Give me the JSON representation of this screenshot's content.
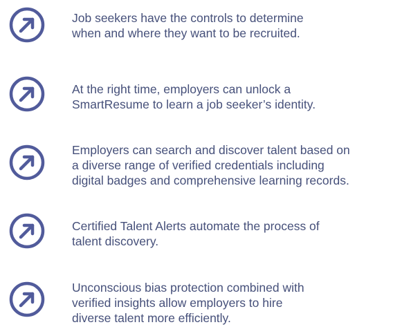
{
  "colors": {
    "icon": "#515b9b",
    "text": "#46507a",
    "background": "#ffffff"
  },
  "icon_name": "arrow-up-right-circle-icon",
  "features": [
    {
      "lines": [
        "Job seekers have the controls to determine",
        "when and where they want to be recruited."
      ]
    },
    {
      "lines": [
        "At the right time, employers can unlock a",
        "SmartResume to learn a job seeker’s identity."
      ]
    },
    {
      "lines": [
        "Employers can search and discover talent based on",
        "a diverse range of verified credentials including",
        "digital badges and comprehensive learning records."
      ]
    },
    {
      "lines": [
        "Certified Talent Alerts automate the process of",
        "talent discovery."
      ]
    },
    {
      "lines": [
        "Unconscious bias protection combined with",
        "verified insights allow employers to hire",
        "diverse talent more efficiently."
      ]
    }
  ]
}
